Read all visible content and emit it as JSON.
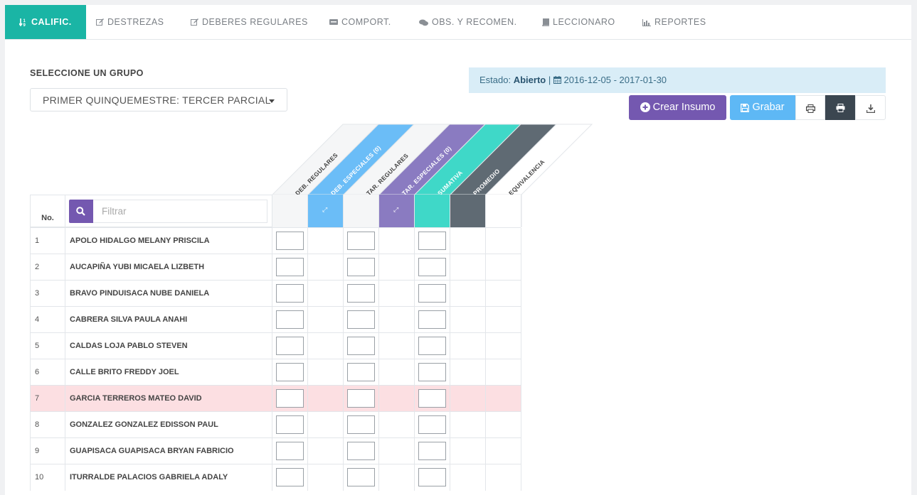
{
  "tabs": [
    {
      "label": "CALIFIC.",
      "icon": "sort-numeric-icon",
      "active": true
    },
    {
      "label": "DESTREZAS",
      "icon": "edit-icon"
    },
    {
      "label": "DEBERES REGULARES",
      "icon": "edit-icon"
    },
    {
      "label": "COMPORT.",
      "icon": "comment-square-icon"
    },
    {
      "label": "OBS. Y RECOMEN.",
      "icon": "comments-icon"
    },
    {
      "label": "LECCIONARO",
      "icon": "book-icon"
    },
    {
      "label": "REPORTES",
      "icon": "bar-chart-icon"
    }
  ],
  "group": {
    "label": "SELECCIONE UN GRUPO",
    "selected": "PRIMER QUINQUEMESTRE: TERCER PARCIAL"
  },
  "status": {
    "prefix": "Estado:",
    "value": "Abierto",
    "separator": "|",
    "dates": "2016-12-05 - 2017-01-30"
  },
  "buttons": {
    "crear": "Crear Insumo",
    "grabar": "Grabar"
  },
  "table": {
    "no_header": "No.",
    "filter_placeholder": "Filtrar",
    "columns": [
      {
        "label": "DEB. REGULARES",
        "color": "#f5f6f7",
        "text_color": "#444",
        "expand": false,
        "input": true
      },
      {
        "label": "DEB. ESPECIALES (0)",
        "color": "#6bbdf7",
        "text_color": "#ffffff",
        "expand": true,
        "input": false
      },
      {
        "label": "TAR. REGULARES",
        "color": "#f5f6f7",
        "text_color": "#444",
        "expand": false,
        "input": true
      },
      {
        "label": "TAR. ESPECIALES (0)",
        "color": "#8a7bc1",
        "text_color": "#ffffff",
        "expand": true,
        "input": false
      },
      {
        "label": "SUMATIVA",
        "color": "#3fd8c8",
        "text_color": "#ffffff",
        "expand": false,
        "input": true
      },
      {
        "label": "PROMEDIO",
        "color": "#5f6a73",
        "text_color": "#ffffff",
        "expand": false,
        "input": false
      },
      {
        "label": "EQUIVALENCIA",
        "color": "#ffffff",
        "text_color": "#444",
        "expand": false,
        "input": false
      }
    ],
    "rows": [
      {
        "no": "1",
        "name": "APOLO HIDALGO MELANY PRISCILA"
      },
      {
        "no": "2",
        "name": "AUCAPIÑA YUBI MICAELA LIZBETH"
      },
      {
        "no": "3",
        "name": "BRAVO PINDUISACA NUBE DANIELA"
      },
      {
        "no": "4",
        "name": "CABRERA SILVA PAULA ANAHI"
      },
      {
        "no": "5",
        "name": "CALDAS LOJA PABLO STEVEN"
      },
      {
        "no": "6",
        "name": "CALLE BRITO FREDDY JOEL"
      },
      {
        "no": "7",
        "name": "GARCIA TERREROS MATEO DAVID",
        "highlight": true
      },
      {
        "no": "8",
        "name": "GONZALEZ GONZALEZ EDISSON PAUL"
      },
      {
        "no": "9",
        "name": "GUAPISACA GUAPISACA BRYAN FABRICIO"
      },
      {
        "no": "10",
        "name": "ITURRALDE PALACIOS GABRIELA ADALY"
      }
    ]
  }
}
